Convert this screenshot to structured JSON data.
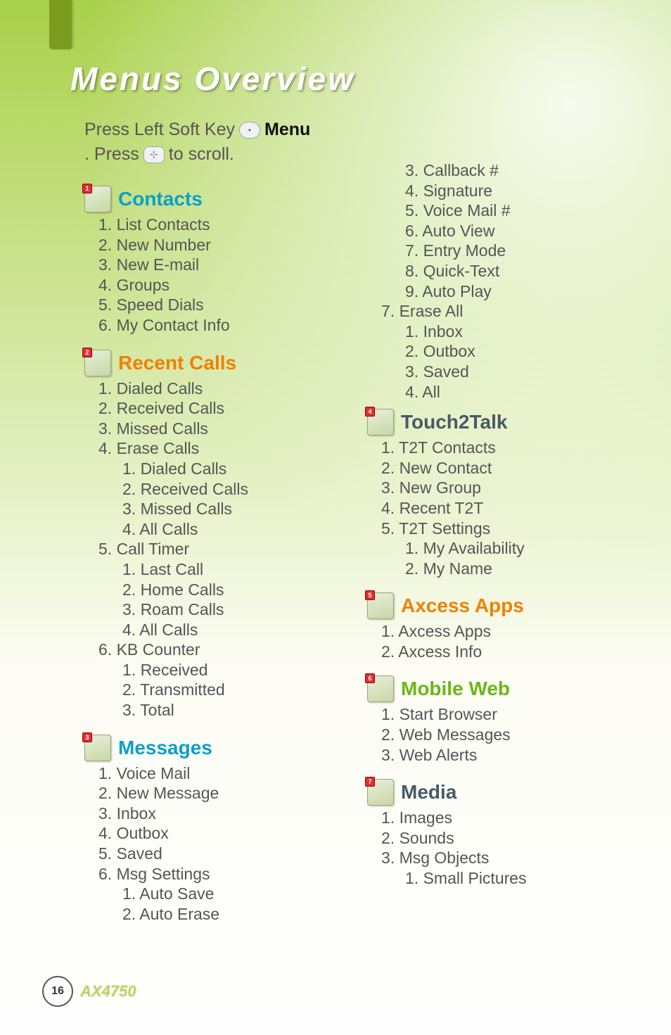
{
  "page_title": "Menus Overview",
  "instruction": {
    "t1": "Press Left Soft Key",
    "menu_word": "Menu",
    "t2": ". Press",
    "t3": "to scroll."
  },
  "footer": {
    "page_number": "16",
    "model": "AX4750"
  },
  "sections": {
    "contacts": {
      "title": "Contacts",
      "badge": "1",
      "items": [
        "1. List Contacts",
        "2. New Number",
        "3. New E-mail",
        "4. Groups",
        "5. Speed Dials",
        "6. My Contact Info"
      ]
    },
    "recent_calls": {
      "title": "Recent Calls",
      "badge": "2",
      "items": [
        "1. Dialed Calls",
        "2. Received Calls",
        "3. Missed Calls"
      ],
      "erase_calls": {
        "label": "4. Erase Calls",
        "sub": [
          "1. Dialed Calls",
          "2. Received Calls",
          "3. Missed Calls",
          "4. All Calls"
        ]
      },
      "call_timer": {
        "label": "5. Call Timer",
        "sub": [
          "1. Last Call",
          "2. Home Calls",
          "3. Roam Calls",
          "4. All Calls"
        ]
      },
      "kb_counter": {
        "label": "6. KB Counter",
        "sub": [
          "1. Received",
          "2. Transmitted",
          "3. Total"
        ]
      }
    },
    "messages": {
      "title": "Messages",
      "badge": "3",
      "items": [
        "1. Voice Mail",
        "2. New Message",
        "3. Inbox",
        "4. Outbox",
        "5. Saved"
      ],
      "msg_settings": {
        "label": "6. Msg Settings",
        "sub_left": [
          "1. Auto Save",
          "2. Auto Erase"
        ],
        "sub_right": [
          "3. Callback #",
          "4. Signature",
          "5. Voice Mail #",
          "6. Auto View",
          "7. Entry Mode",
          "8. Quick-Text",
          "9. Auto Play"
        ]
      },
      "erase_all": {
        "label": "7. Erase All",
        "sub": [
          "1. Inbox",
          "2. Outbox",
          "3. Saved",
          "4. All"
        ]
      }
    },
    "touch2talk": {
      "title": "Touch2Talk",
      "badge": "4",
      "items": [
        "1. T2T Contacts",
        "2. New Contact",
        "3. New Group",
        "4. Recent T2T"
      ],
      "t2t_settings": {
        "label": "5. T2T Settings",
        "sub": [
          "1. My Availability",
          "2. My Name"
        ]
      }
    },
    "axcess": {
      "title": "Axcess Apps",
      "badge": "5",
      "items": [
        "1. Axcess Apps",
        "2. Axcess Info"
      ]
    },
    "mobile_web": {
      "title": "Mobile Web",
      "badge": "6",
      "items": [
        "1. Start Browser",
        "2. Web Messages",
        "3. Web Alerts"
      ]
    },
    "media": {
      "title": "Media",
      "badge": "7",
      "items": [
        "1. Images",
        "2. Sounds"
      ],
      "msg_objects": {
        "label": "3. Msg Objects",
        "sub": [
          "1. Small Pictures"
        ]
      }
    }
  }
}
